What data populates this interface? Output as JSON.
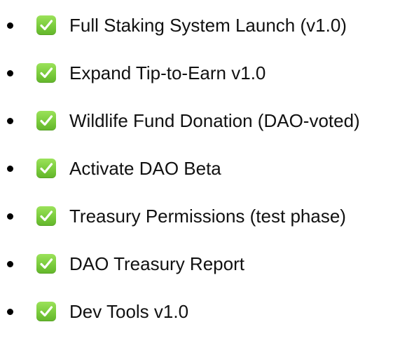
{
  "checklist": {
    "items": [
      {
        "label": "Full Staking System Launch (v1.0)",
        "status": "done",
        "icon": "check-mark-button-icon"
      },
      {
        "label": "Expand Tip-to-Earn v1.0",
        "status": "done",
        "icon": "check-mark-button-icon"
      },
      {
        "label": "Wildlife Fund Donation (DAO-voted)",
        "status": "done",
        "icon": "check-mark-button-icon"
      },
      {
        "label": "Activate DAO Beta",
        "status": "done",
        "icon": "check-mark-button-icon"
      },
      {
        "label": "Treasury Permissions (test phase)",
        "status": "done",
        "icon": "check-mark-button-icon"
      },
      {
        "label": "DAO Treasury Report",
        "status": "done",
        "icon": "check-mark-button-icon"
      },
      {
        "label": "Dev Tools v1.0",
        "status": "done",
        "icon": "check-mark-button-icon"
      }
    ]
  },
  "colors": {
    "check_green": "#78c93b",
    "text": "#111111",
    "bullet": "#000000",
    "background": "#ffffff"
  }
}
